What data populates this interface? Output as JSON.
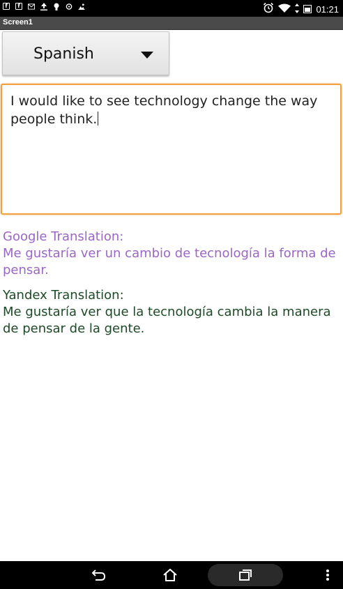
{
  "status_bar": {
    "time": "01:21",
    "notification_icons": [
      "notif-f-icon",
      "notif-f-icon",
      "message-icon",
      "upload-icon",
      "android-icon",
      "sync-icon",
      "image-icon"
    ],
    "right_icons": [
      "alarm-icon",
      "wifi-icon",
      "data-arrows-icon",
      "battery-icon"
    ]
  },
  "app": {
    "title": "Screen1"
  },
  "language_spinner": {
    "selected": "Spanish"
  },
  "input": {
    "value": "I would like to see technology change the way people think."
  },
  "google": {
    "label": "Google Translation:",
    "text": "Me gustaría ver un cambio de tecnología la forma de pensar."
  },
  "yandex": {
    "label": "Yandex Translation:",
    "text": "Me gustaría ver que la tecnología cambia la manera de pensar de la gente."
  },
  "nav": {
    "buttons": [
      "back-icon",
      "home-icon",
      "recent-apps-icon",
      "overflow-menu-icon"
    ]
  },
  "colors": {
    "status_bar": "#000000",
    "title_bar": "#4a4a4a",
    "focus_border": "#f0a040",
    "google_text": "#9a66c6",
    "yandex_text": "#1c4a28"
  }
}
